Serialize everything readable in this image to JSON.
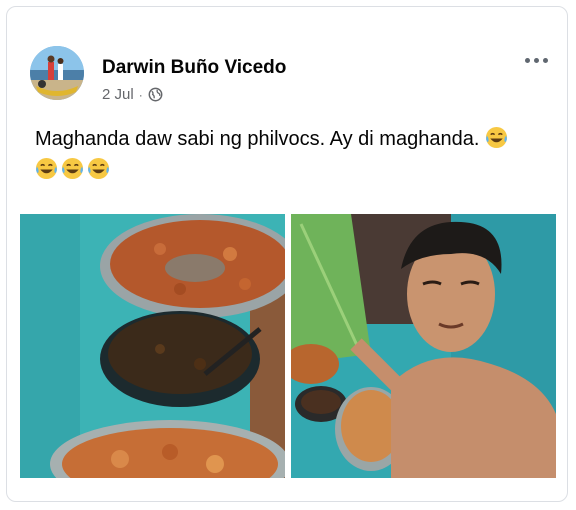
{
  "post": {
    "author": "Darwin Buño Vicedo",
    "date": "2 Jul",
    "separator": "·",
    "audience_icon": "globe-icon",
    "more_icon": "more-options-icon",
    "text": "Maghanda daw sabi ng philvocs. Ay di maghanda.",
    "emojis": [
      "laughing-tears-emoji",
      "laughing-tears-emoji",
      "laughing-tears-emoji",
      "laughing-tears-emoji"
    ]
  },
  "colors": {
    "author_text": "#050505",
    "meta_text": "#65676b",
    "card_border": "#dcdfe4",
    "wall_teal": "#3fb0b3"
  },
  "photos": [
    {
      "name": "photo-food-pots"
    },
    {
      "name": "photo-selfie-with-food"
    }
  ]
}
